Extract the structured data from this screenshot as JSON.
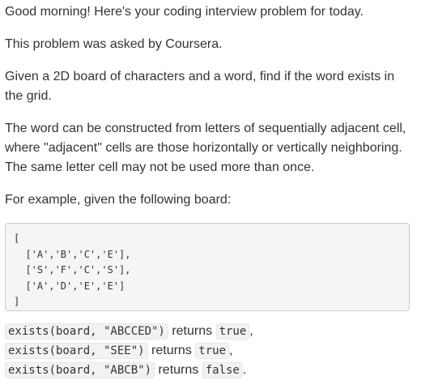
{
  "intro": {
    "greeting": "Good morning! Here's your coding interview problem for today.",
    "asked_by": "This problem was asked by Coursera."
  },
  "problem": {
    "statement": "Given a 2D board of characters and a word, find if the word exists in the grid.",
    "rules": "The word can be constructed from letters of sequentially adjacent cell, where \"adjacent\" cells are those horizontally or vertically neighboring. The same letter cell may not be used more than once.",
    "example_intro": "For example, given the following board:"
  },
  "board": {
    "open": "[",
    "rows": [
      "  ['A','B','C','E'],",
      "  ['S','F','C','S'],",
      "  ['A','D','E','E']"
    ],
    "close": "]"
  },
  "examples": [
    {
      "call": "exists(board, \"ABCCED\")",
      "word": "returns",
      "result": "true",
      "punct": ","
    },
    {
      "call": "exists(board, \"SEE\")",
      "word": "returns",
      "result": "true",
      "punct": ","
    },
    {
      "call": "exists(board, \"ABCB\")",
      "word": "returns",
      "result": "false",
      "punct": "."
    }
  ]
}
